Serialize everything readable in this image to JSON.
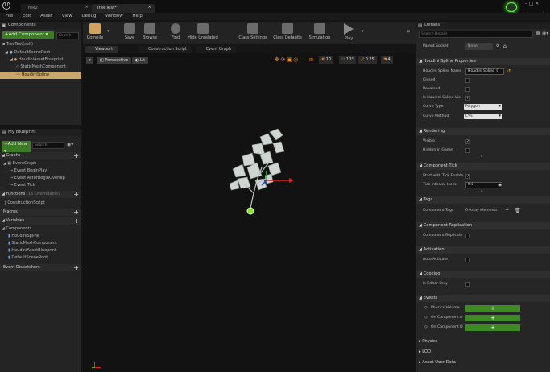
{
  "titlebar": {
    "tabs": [
      "Tree2",
      "TreeTest*"
    ],
    "parent_class_label": "Parent class",
    "parent_class_value": "Act"
  },
  "menu": [
    "File",
    "Edit",
    "Asset",
    "View",
    "Debug",
    "Window",
    "Help"
  ],
  "toolbar": {
    "buttons": [
      "Compile",
      "Save",
      "Browse",
      "Find",
      "Hide Unrelated",
      "Class Settings",
      "Class Defaults",
      "Simulation",
      "Play"
    ],
    "overflow": "»"
  },
  "components_panel": {
    "title": "Components",
    "add_button": "+Add Component ▾",
    "search_placeholder": "Search",
    "self_item": "TreeTest(self)",
    "tree": [
      "DefaultSceneRoot",
      "HoudiniAssetBlueprint",
      "StaticMeshComponent",
      "HoudiniSpline"
    ]
  },
  "blueprint_panel": {
    "title": "My Blueprint",
    "add_new": "+Add New ▾",
    "search_placeholder": "Search",
    "graphs_label": "Graphs",
    "event_graph": "EventGraph",
    "events": [
      "Event BeginPlay",
      "Event ActorBeginOverlap",
      "Event Tick"
    ],
    "functions_label": "Functions",
    "functions_count": "(16 Overridable)",
    "construction_script": "ConstructionScript",
    "macros_label": "Macros",
    "variables_label": "Variables",
    "components_label": "Components",
    "components": [
      "HoudiniSpline",
      "StaticMeshComponent",
      "HoudiniAssetBlueprint",
      "DefaultSceneRoot"
    ],
    "dispatchers_label": "Event Dispatchers"
  },
  "viewport": {
    "tabs": [
      "Viewport",
      "Construction Script",
      "Event Graph"
    ],
    "perspective": "Perspective",
    "lit": "Lit",
    "grid_snap": "10",
    "rot_snap": "10°",
    "scale_snap": "0.25",
    "camera_speed": "4"
  },
  "details": {
    "title": "Details",
    "search_placeholder": "Search Details",
    "parent_socket_label": "Parent Socket",
    "parent_socket_value": "None",
    "section_houdini": "Houdini Spline Properties",
    "spline_name_label": "Houdini Spline Name",
    "spline_name_value": "Houdini Spline_0",
    "closed_label": "Closed",
    "reversed_label": "Reversed",
    "visible_label": "Is Houdini Spline Visi",
    "curve_type_label": "Curve Type",
    "curve_type_value": "Polygon",
    "curve_method_label": "Curve Method",
    "curve_method_value": "CVs",
    "section_rendering": "Rendering",
    "visible_r_label": "Visible",
    "hidden_label": "Hidden in Game",
    "section_tick": "Component Tick",
    "start_tick_label": "Start with Tick Enable",
    "tick_interval_label": "Tick Interval (secs)",
    "tick_interval_value": "0.0",
    "section_tags": "Tags",
    "tags_label": "Component Tags",
    "tags_value": "0 Array elements",
    "section_replication": "Component Replication",
    "replicates_label": "Component Replicate",
    "section_activation": "Activation",
    "auto_activate_label": "Auto Activate",
    "section_cooking": "Cooking",
    "editor_only_label": "Is Editor Only",
    "section_events": "Events",
    "events": [
      "Physics Volume",
      "On Component A",
      "On Component D"
    ],
    "collapsed": [
      "Physics",
      "LOD",
      "Asset User Data"
    ]
  }
}
